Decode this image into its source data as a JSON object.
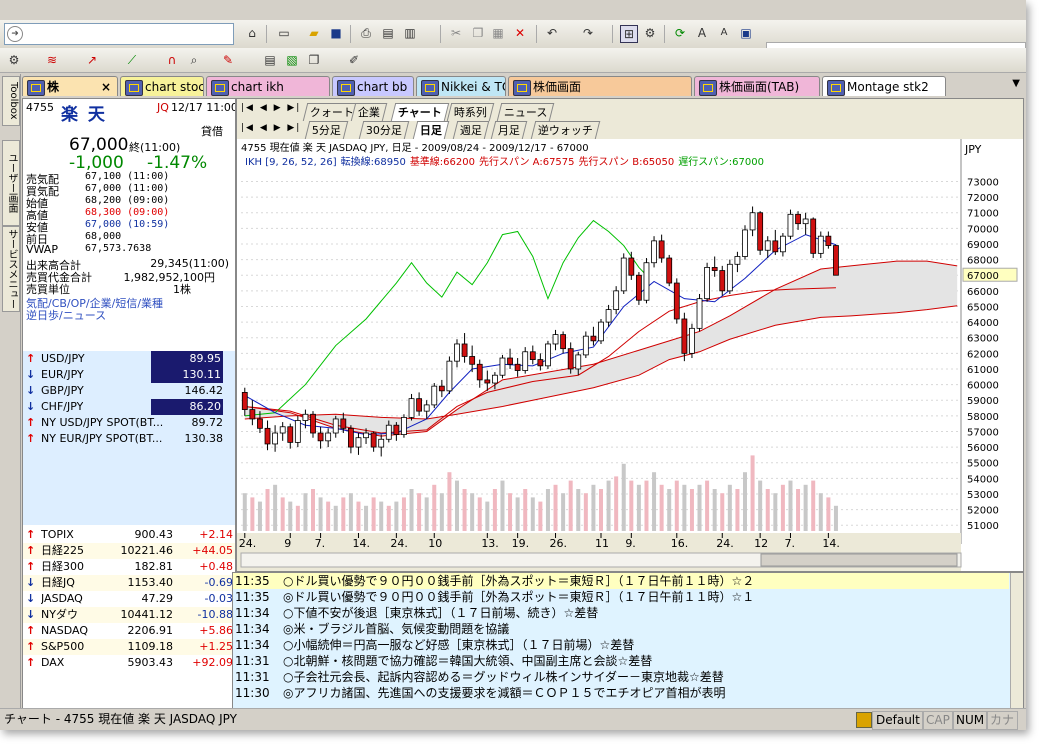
{
  "toolbar_icons": [
    "back-forward-icon",
    "home-icon",
    "new-icon",
    "open-icon",
    "save-icon",
    "print-icon",
    "preview-icon",
    "copy-page-icon",
    "cut-icon",
    "copy-icon",
    "paste-icon",
    "delete-icon",
    "undo-icon",
    "redo-icon",
    "layout-icon",
    "settings-icon",
    "refresh-icon",
    "font-larger-icon",
    "font-smaller-icon",
    "window-icon"
  ],
  "tabs": [
    {
      "label": "株",
      "color": "#fbe3b0",
      "active": true,
      "close": "×"
    },
    {
      "label": "chart stock",
      "color": "#f7f29a"
    },
    {
      "label": "chart ikh",
      "color": "#f0b6d8"
    },
    {
      "label": "chart bb",
      "color": "#c8c8ff"
    },
    {
      "label": "Nikkei & TOPIX charts",
      "color": "#bfe6f5"
    },
    {
      "label": "株価画面",
      "color": "#f7c99a"
    },
    {
      "label": "株価画面(TAB)",
      "color": "#f0b6d8"
    },
    {
      "label": "Montage stk2",
      "color": "#ffffff"
    }
  ],
  "side_strip": {
    "toolbox": "Toolbox",
    "user_screen": "ユーザー画面",
    "service_menu": "サービスメニュー"
  },
  "quote": {
    "code": "4755",
    "name": "楽 天",
    "exchange": "JQ",
    "date_time": "12/17 11:00",
    "price": "67,000",
    "price_note": "終(11:00)",
    "order": "貸借",
    "change": "-1,000",
    "change_pct": "-1.47%",
    "rows": [
      {
        "label": "売気配",
        "value": "67,100 (11:00)"
      },
      {
        "label": "買気配",
        "value": "67,000 (11:00)"
      },
      {
        "label": "始値",
        "value": "68,200 (09:00)"
      },
      {
        "label": "高値",
        "value": "68,300 (09:00)",
        "color": "#e00000"
      },
      {
        "label": "安値",
        "value": "67,000 (10:59)",
        "color": "#1030a0"
      },
      {
        "label": "前日",
        "value": "68,000"
      },
      {
        "label": "VWAP",
        "value": "67,573.7638"
      }
    ],
    "volume_label": "出来高合計",
    "volume": "29,345(11:00)",
    "turnover_label": "売買代金合計",
    "turnover": "1,982,952,100円",
    "unit_label": "売買単位",
    "unit": "1株",
    "links": "気配/CB/OP/企業/短信/業種",
    "links2": "逆日歩/ニュース"
  },
  "fx": [
    {
      "dir": "up",
      "name": "USD/JPY",
      "value": "89.95",
      "hl": true
    },
    {
      "dir": "dn",
      "name": "EUR/JPY",
      "value": "130.11",
      "hl": true
    },
    {
      "dir": "dn",
      "name": "GBP/JPY",
      "value": "146.42",
      "hl": false
    },
    {
      "dir": "dn",
      "name": "CHF/JPY",
      "value": "86.20",
      "hl": true
    },
    {
      "dir": "up",
      "name": "NY USD/JPY SPOT(BT...",
      "value": "89.72",
      "hl": false
    },
    {
      "dir": "up",
      "name": "NY EUR/JPY SPOT(BT...",
      "value": "130.38",
      "hl": false
    }
  ],
  "indices": [
    {
      "dir": "up",
      "name": "TOPIX",
      "value": "900.43",
      "change": "+2.14"
    },
    {
      "dir": "up",
      "name": "日経225",
      "value": "10221.46",
      "change": "+44.05"
    },
    {
      "dir": "up",
      "name": "日経300",
      "value": "182.81",
      "change": "+0.48"
    },
    {
      "dir": "dn",
      "name": "日経JQ",
      "value": "1153.40",
      "change": "-0.69"
    },
    {
      "dir": "dn",
      "name": "JASDAQ",
      "value": "47.29",
      "change": "-0.03"
    },
    {
      "dir": "dn",
      "name": "NYダウ",
      "value": "10441.12",
      "change": "-10.88"
    },
    {
      "dir": "up",
      "name": "NASDAQ",
      "value": "2206.91",
      "change": "+5.86"
    },
    {
      "dir": "up",
      "name": "S&P500",
      "value": "1109.18",
      "change": "+1.25"
    },
    {
      "dir": "up",
      "name": "DAX",
      "value": "5903.43",
      "change": "+92.09"
    }
  ],
  "chart_tabs_top": [
    "クォート",
    "企業",
    "チャート",
    "時系列",
    "ニュース"
  ],
  "chart_tabs_bottom": [
    "5分足",
    "30分足",
    "日足",
    "週足",
    "月足",
    "逆ウォッチ"
  ],
  "chart_nav": "|◀ ◀ ▶ ▶|",
  "chart_header": "4755 現在値 楽 天 JASDAQ JPY, 日足 - 2009/08/24 - 2009/12/17 - 67000",
  "chart_legend": {
    "prefix": "IKH [9, 26, 52, 26]",
    "tenkan": "転換線:68950",
    "kijun": "基準線:66200",
    "spanA": "先行スパン A:67575",
    "spanB": "先行スパン B:65050",
    "chikou": "遅行スパン:67000"
  },
  "chart_data": {
    "type": "candlestick",
    "currency_label": "JPY",
    "ylim": [
      50500,
      73800
    ],
    "y_ticks": [
      51000,
      52000,
      53000,
      54000,
      55000,
      56000,
      57000,
      58000,
      59000,
      60000,
      61000,
      62000,
      63000,
      64000,
      65000,
      66000,
      67000,
      68000,
      69000,
      70000,
      71000,
      72000,
      73000
    ],
    "last_price": 67000,
    "x_labels": [
      {
        "i": 0,
        "t": "24."
      },
      {
        "i": 6,
        "t": "9"
      },
      {
        "i": 10,
        "t": "7."
      },
      {
        "i": 15,
        "t": "14."
      },
      {
        "i": 20,
        "t": "24."
      },
      {
        "i": 25,
        "t": "10"
      },
      {
        "i": 32,
        "t": "13."
      },
      {
        "i": 36,
        "t": "19."
      },
      {
        "i": 41,
        "t": "26."
      },
      {
        "i": 47,
        "t": "11"
      },
      {
        "i": 51,
        "t": "9."
      },
      {
        "i": 57,
        "t": "16."
      },
      {
        "i": 63,
        "t": "24."
      },
      {
        "i": 68,
        "t": "12"
      },
      {
        "i": 72,
        "t": "7."
      },
      {
        "i": 77,
        "t": "14."
      }
    ],
    "candles": [
      [
        59500,
        59800,
        58000,
        58400
      ],
      [
        58400,
        59000,
        57400,
        57800
      ],
      [
        57800,
        58300,
        56900,
        57200
      ],
      [
        57200,
        57700,
        55800,
        56200
      ],
      [
        56200,
        57400,
        55700,
        56900
      ],
      [
        56900,
        57600,
        56400,
        57300
      ],
      [
        57300,
        57500,
        55900,
        56300
      ],
      [
        56300,
        58000,
        56000,
        57700
      ],
      [
        57700,
        58400,
        57200,
        58100
      ],
      [
        58100,
        58300,
        56600,
        56900
      ],
      [
        56900,
        57300,
        55900,
        56400
      ],
      [
        56400,
        57200,
        56000,
        56900
      ],
      [
        56900,
        58000,
        56600,
        57800
      ],
      [
        57800,
        58200,
        56900,
        57200
      ],
      [
        57200,
        57400,
        55600,
        56000
      ],
      [
        56000,
        56900,
        55500,
        56600
      ],
      [
        56600,
        57200,
        56200,
        56900
      ],
      [
        56900,
        57000,
        55700,
        56000
      ],
      [
        56000,
        56800,
        55400,
        56500
      ],
      [
        56500,
        57700,
        56300,
        57400
      ],
      [
        57400,
        57600,
        56400,
        56800
      ],
      [
        56800,
        58100,
        56600,
        57900
      ],
      [
        57900,
        59400,
        57700,
        59100
      ],
      [
        59100,
        59500,
        58000,
        58300
      ],
      [
        58300,
        59000,
        57800,
        58700
      ],
      [
        58700,
        60100,
        58500,
        59900
      ],
      [
        59900,
        60300,
        59200,
        59600
      ],
      [
        59600,
        61800,
        59400,
        61500
      ],
      [
        61500,
        62900,
        61100,
        62600
      ],
      [
        62600,
        63300,
        61400,
        61800
      ],
      [
        61800,
        62500,
        60800,
        61300
      ],
      [
        61300,
        61600,
        59800,
        60300
      ],
      [
        60300,
        60900,
        59600,
        60100
      ],
      [
        60100,
        60800,
        59700,
        60600
      ],
      [
        60600,
        61900,
        60400,
        61700
      ],
      [
        61700,
        62300,
        61000,
        61300
      ],
      [
        61300,
        61700,
        60500,
        60900
      ],
      [
        60900,
        62400,
        60700,
        62100
      ],
      [
        62100,
        62500,
        61300,
        61600
      ],
      [
        61600,
        62000,
        60900,
        61200
      ],
      [
        61200,
        62800,
        61000,
        62600
      ],
      [
        62600,
        63500,
        62200,
        63200
      ],
      [
        63200,
        63400,
        62000,
        62300
      ],
      [
        62300,
        62700,
        60700,
        61000
      ],
      [
        61000,
        62100,
        60600,
        61900
      ],
      [
        61900,
        63400,
        61700,
        63100
      ],
      [
        63100,
        63700,
        62500,
        62800
      ],
      [
        62800,
        64200,
        62600,
        64000
      ],
      [
        64000,
        65100,
        63700,
        64800
      ],
      [
        64800,
        66300,
        64500,
        66000
      ],
      [
        66000,
        68400,
        65800,
        68100
      ],
      [
        68100,
        68500,
        66700,
        67000
      ],
      [
        67000,
        67200,
        65100,
        65400
      ],
      [
        65400,
        68100,
        65200,
        67800
      ],
      [
        67800,
        69500,
        67500,
        69200
      ],
      [
        69200,
        69600,
        67800,
        68100
      ],
      [
        68100,
        68300,
        66300,
        66500
      ],
      [
        66500,
        66800,
        63900,
        64200
      ],
      [
        64200,
        64600,
        61500,
        62000
      ],
      [
        62000,
        63900,
        61700,
        63600
      ],
      [
        63600,
        65800,
        63400,
        65500
      ],
      [
        65500,
        67800,
        65300,
        67500
      ],
      [
        67500,
        68200,
        66900,
        67300
      ],
      [
        67300,
        67600,
        65700,
        66000
      ],
      [
        66000,
        68000,
        65800,
        67700
      ],
      [
        67700,
        68500,
        67200,
        68200
      ],
      [
        68200,
        70200,
        68000,
        69900
      ],
      [
        69900,
        71400,
        69500,
        71000
      ],
      [
        71000,
        71100,
        68300,
        68600
      ],
      [
        68600,
        69500,
        68100,
        69200
      ],
      [
        69200,
        69900,
        68300,
        68500
      ],
      [
        68500,
        69700,
        68200,
        69500
      ],
      [
        69500,
        71200,
        69300,
        70900
      ],
      [
        70900,
        71100,
        69900,
        70300
      ],
      [
        70300,
        71000,
        69600,
        70600
      ],
      [
        70600,
        70700,
        68100,
        68400
      ],
      [
        68400,
        69800,
        68100,
        69500
      ],
      [
        69500,
        69800,
        68700,
        68900
      ],
      [
        68900,
        68950,
        67000,
        67000
      ]
    ],
    "volume_ratio": [
      0.45,
      0.4,
      0.35,
      0.5,
      0.55,
      0.4,
      0.35,
      0.3,
      0.45,
      0.5,
      0.4,
      0.35,
      0.3,
      0.4,
      0.45,
      0.35,
      0.3,
      0.4,
      0.35,
      0.3,
      0.35,
      0.4,
      0.5,
      0.45,
      0.4,
      0.55,
      0.45,
      0.7,
      0.6,
      0.5,
      0.45,
      0.4,
      0.35,
      0.5,
      0.6,
      0.45,
      0.4,
      0.5,
      0.4,
      0.35,
      0.5,
      0.55,
      0.45,
      0.6,
      0.5,
      0.45,
      0.55,
      0.5,
      0.6,
      0.65,
      0.8,
      0.6,
      0.55,
      0.6,
      0.7,
      0.55,
      0.5,
      0.6,
      0.55,
      0.5,
      0.55,
      0.6,
      0.5,
      0.45,
      0.55,
      0.5,
      0.7,
      0.9,
      0.6,
      0.5,
      0.45,
      0.55,
      0.6,
      0.5,
      0.55,
      0.6,
      0.45,
      0.4,
      0.3
    ],
    "tenkan": [
      [
        0,
        59300
      ],
      [
        4,
        58200
      ],
      [
        8,
        57400
      ],
      [
        12,
        57200
      ],
      [
        16,
        56800
      ],
      [
        20,
        56900
      ],
      [
        24,
        57800
      ],
      [
        27,
        59500
      ],
      [
        30,
        61000
      ],
      [
        34,
        61300
      ],
      [
        38,
        61200
      ],
      [
        42,
        62000
      ],
      [
        46,
        62400
      ],
      [
        50,
        65000
      ],
      [
        54,
        66600
      ],
      [
        58,
        65500
      ],
      [
        62,
        65300
      ],
      [
        66,
        66800
      ],
      [
        70,
        68600
      ],
      [
        74,
        69600
      ],
      [
        78,
        68950
      ]
    ],
    "kijun": [
      [
        0,
        58600
      ],
      [
        6,
        58300
      ],
      [
        12,
        57400
      ],
      [
        18,
        56900
      ],
      [
        24,
        57100
      ],
      [
        28,
        58600
      ],
      [
        32,
        59500
      ],
      [
        38,
        60200
      ],
      [
        44,
        60600
      ],
      [
        48,
        61800
      ],
      [
        52,
        63400
      ],
      [
        56,
        64700
      ],
      [
        60,
        65300
      ],
      [
        64,
        65700
      ],
      [
        68,
        66000
      ],
      [
        72,
        66100
      ],
      [
        78,
        66200
      ]
    ],
    "chikou": [
      [
        0,
        58000
      ],
      [
        4,
        58200
      ],
      [
        8,
        60000
      ],
      [
        12,
        62500
      ],
      [
        16,
        64200
      ],
      [
        20,
        66500
      ],
      [
        22,
        67800
      ],
      [
        24,
        66500
      ],
      [
        26,
        65600
      ],
      [
        28,
        67200
      ],
      [
        30,
        66400
      ],
      [
        32,
        67800
      ],
      [
        34,
        69600
      ],
      [
        36,
        69800
      ],
      [
        38,
        68200
      ],
      [
        40,
        65500
      ],
      [
        42,
        67800
      ],
      [
        44,
        69400
      ],
      [
        46,
        70500
      ],
      [
        48,
        69800
      ],
      [
        50,
        68900
      ],
      [
        52,
        67500
      ],
      [
        53,
        67000
      ]
    ],
    "spanA": [
      [
        0,
        58600
      ],
      [
        6,
        58200
      ],
      [
        12,
        57200
      ],
      [
        18,
        56700
      ],
      [
        24,
        57000
      ],
      [
        28,
        58400
      ],
      [
        34,
        60300
      ],
      [
        40,
        60800
      ],
      [
        46,
        61300
      ],
      [
        52,
        62200
      ],
      [
        56,
        62800
      ],
      [
        60,
        63400
      ],
      [
        64,
        64400
      ],
      [
        70,
        66100
      ],
      [
        76,
        67400
      ],
      [
        82,
        67700
      ],
      [
        86,
        67900
      ],
      [
        90,
        67900
      ],
      [
        94,
        67600
      ]
    ],
    "spanB": [
      [
        0,
        57800
      ],
      [
        6,
        58000
      ],
      [
        12,
        58100
      ],
      [
        18,
        57900
      ],
      [
        24,
        57800
      ],
      [
        28,
        58100
      ],
      [
        34,
        58600
      ],
      [
        40,
        59200
      ],
      [
        46,
        59800
      ],
      [
        52,
        60600
      ],
      [
        56,
        61600
      ],
      [
        60,
        62100
      ],
      [
        64,
        62900
      ],
      [
        70,
        63800
      ],
      [
        76,
        64300
      ],
      [
        80,
        64400
      ],
      [
        86,
        64600
      ],
      [
        90,
        64800
      ],
      [
        94,
        65050
      ]
    ]
  },
  "news": [
    {
      "time": "11:35",
      "text": "○ドル買い優勢で９０円００銭手前［外為スポット＝東短Ｒ］（１７日午前１１時）☆２",
      "hl": true
    },
    {
      "time": "11:35",
      "text": "◎ドル買い優勢で９０円００銭手前［外為スポット＝東短Ｒ］（１７日午前１１時）☆１",
      "hl": false
    },
    {
      "time": "11:34",
      "text": "○下値不安が後退［東京株式］（１７日前場、続き）☆差替",
      "hl": false
    },
    {
      "time": "11:34",
      "text": "◎米・ブラジル首脳、気候変動問題を協議",
      "hl": false
    },
    {
      "time": "11:34",
      "text": "○小幅続伸＝円高一服など好感［東京株式］（１７日前場）☆差替",
      "hl": false
    },
    {
      "time": "11:31",
      "text": "○北朝鮮・核問題で協力確認＝韓国大統領、中国副主席と会談☆差替",
      "hl": false
    },
    {
      "time": "11:31",
      "text": "○子会社元会長、起訴内容認める＝グッドウィル株インサイダー－東京地裁☆差替",
      "hl": false
    },
    {
      "time": "11:30",
      "text": "◎アフリカ諸国、先進国への支援要求を減額＝ＣＯＰ１５でエチオピア首相が表明",
      "hl": false
    }
  ],
  "status": {
    "text": "チャート - 4755 現在値 楽 天 JASDAQ JPY",
    "layout": "Default",
    "cap": "CAP",
    "num": "NUM",
    "kana": "カナ"
  }
}
